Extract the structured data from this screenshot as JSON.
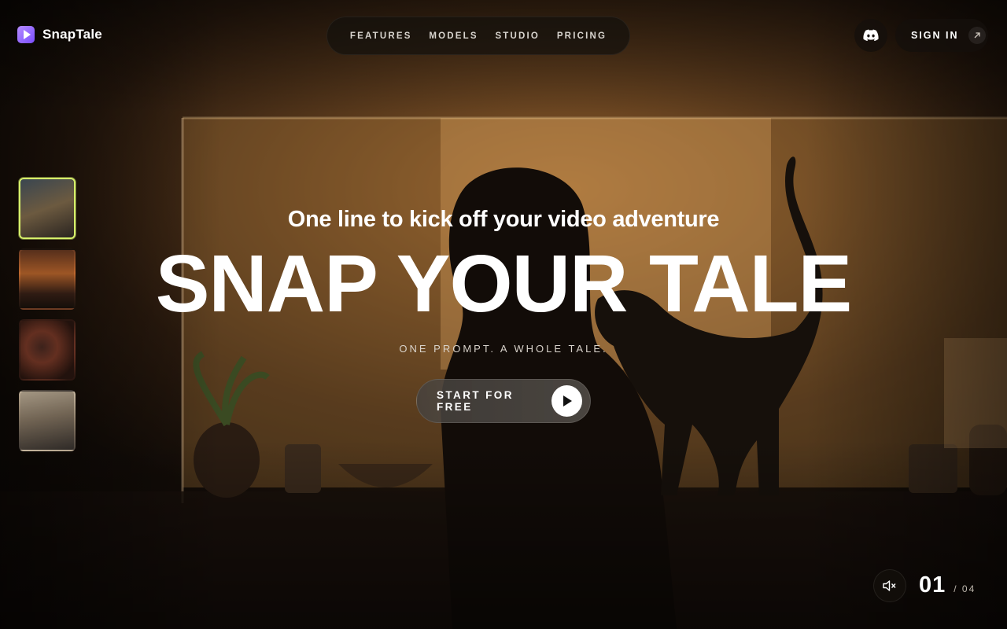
{
  "brand": {
    "name": "SnapTale"
  },
  "nav": {
    "items": [
      {
        "label": "FEATURES"
      },
      {
        "label": "MODELS"
      },
      {
        "label": "STUDIO"
      },
      {
        "label": "PRICING"
      }
    ]
  },
  "header": {
    "discord_icon": "discord-icon",
    "signin_label": "SIGN IN",
    "signin_icon": "arrow-up-right-icon"
  },
  "thumbnails": [
    {
      "active": true
    },
    {
      "active": false
    },
    {
      "active": false
    },
    {
      "active": false
    }
  ],
  "hero": {
    "tagline": "One line to kick off your video adventure",
    "title": "SNAP YOUR TALE",
    "subtitle": "ONE PROMPT. A WHOLE TALE.",
    "cta_label": "START FOR FREE",
    "cta_icon": "play-icon"
  },
  "player": {
    "mute_icon": "muted-speaker-icon",
    "current": "01",
    "total": "/ 04"
  },
  "colors": {
    "accent": "#d6f06a",
    "brand": "#8a5cff"
  }
}
